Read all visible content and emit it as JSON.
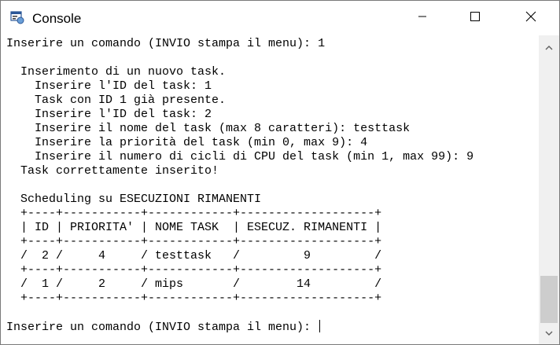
{
  "window": {
    "title": "Console",
    "icon": "console-app-icon",
    "controls": {
      "minimize": "minimize-icon",
      "maximize": "maximize-icon",
      "close": "close-icon"
    }
  },
  "console": {
    "lines": [
      "Inserire un comando (INVIO stampa il menu): 1",
      "",
      "  Inserimento di un nuovo task.",
      "    Inserire l'ID del task: 1",
      "    Task con ID 1 già presente.",
      "    Inserire l'ID del task: 2",
      "    Inserire il nome del task (max 8 caratteri): testtask",
      "    Inserire la priorità del task (min 0, max 9): 4",
      "    Inserire il numero di cicli di CPU del task (min 1, max 99): 9",
      "  Task correttamente inserito!",
      "",
      "  Scheduling su ESECUZIONI RIMANENTI",
      "  +----+-----------+------------+-------------------+",
      "  | ID | PRIORITA' | NOME TASK  | ESECUZ. RIMANENTI |",
      "  +----+-----------+------------+-------------------+",
      "  /  2 /     4     / testtask   /         9         /",
      "  +----+-----------+------------+-------------------+",
      "  /  1 /     2     / mips       /        14         /",
      "  +----+-----------+------------+-------------------+",
      "",
      "Inserire un comando (INVIO stampa il menu): "
    ]
  },
  "scrollbar": {
    "up_icon": "scroll-up-arrow-icon",
    "down_icon": "scroll-down-arrow-icon"
  }
}
